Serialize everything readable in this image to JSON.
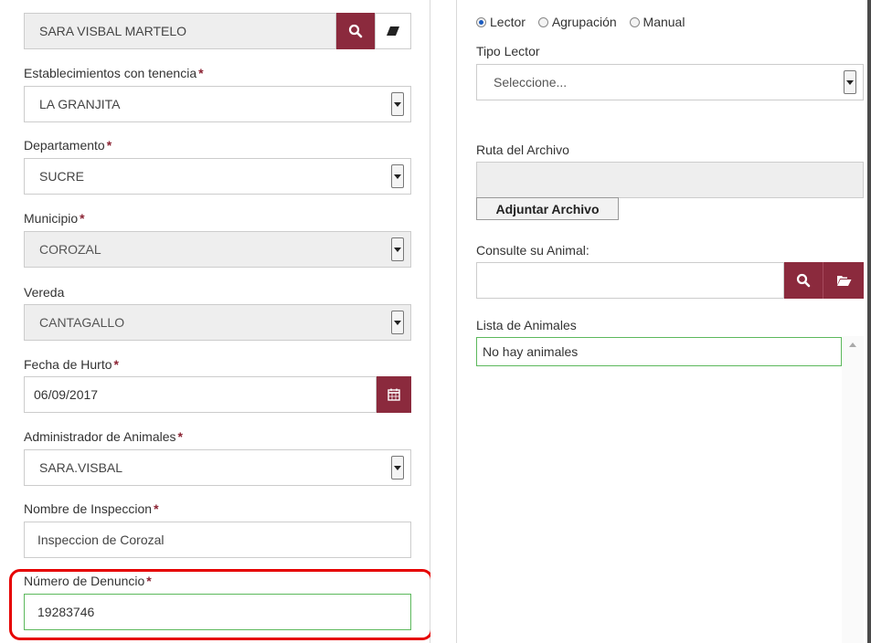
{
  "left_form": {
    "owner": {
      "value": "SARA VISBAL MARTELO"
    },
    "establishments": {
      "label": "Establecimientos con tenencia",
      "value": "LA GRANJITA"
    },
    "department": {
      "label": "Departamento",
      "value": "SUCRE"
    },
    "municipality": {
      "label": "Municipio",
      "value": "COROZAL"
    },
    "vereda": {
      "label": "Vereda",
      "value": "CANTAGALLO"
    },
    "theft_date": {
      "label": "Fecha de Hurto",
      "value": "06/09/2017"
    },
    "animal_admin": {
      "label": "Administrador de Animales",
      "value": "SARA.VISBAL"
    },
    "inspection_name": {
      "label": "Nombre de Inspeccion",
      "value": "Inspeccion de Corozal"
    },
    "complaint_number": {
      "label": "Número de Denuncio",
      "value": "19283746"
    },
    "required_mark": "*"
  },
  "right_form": {
    "mode_options": [
      "Lector",
      "Agrupación",
      "Manual"
    ],
    "selected_mode": "Lector",
    "reader_type": {
      "label": "Tipo Lector",
      "value": "Seleccione..."
    },
    "file_path": {
      "label": "Ruta del Archivo",
      "value": ""
    },
    "attach_button": "Adjuntar Archivo",
    "animal_search": {
      "label": "Consulte su Animal:",
      "value": ""
    },
    "animal_list": {
      "label": "Lista de Animales",
      "empty_text": "No hay animales"
    }
  },
  "colors": {
    "accent": "#8b2a3d",
    "highlight_border": "#e60000",
    "success_border": "#5cb85c"
  },
  "icons": [
    "search-icon",
    "eraser-icon",
    "calendar-icon",
    "folder-open-icon",
    "chevron-down-icon"
  ]
}
